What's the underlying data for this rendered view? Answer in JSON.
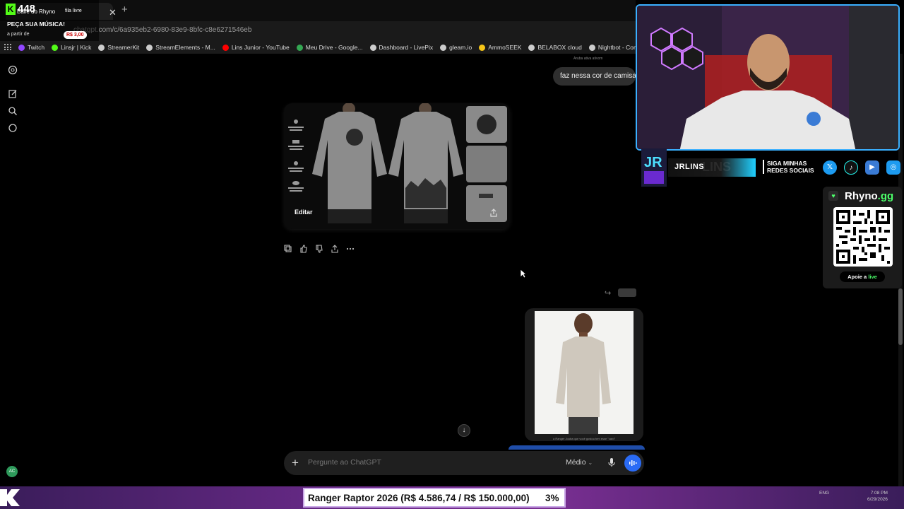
{
  "browser": {
    "url": "chatgpt.com/c/6a935eb2-6980-83e9-8bfc-c8e6271546eb",
    "bookmarks": [
      {
        "label": "Twitch",
        "color": "#9146ff"
      },
      {
        "label": "Linsjr | Kick",
        "color": "#53fc18"
      },
      {
        "label": "StreamerKit",
        "color": "#cccccc"
      },
      {
        "label": "StreamElements - M...",
        "color": "#cccccc"
      },
      {
        "label": "Lins Junior - YouTube",
        "color": "#ff0000"
      },
      {
        "label": "Meu Drive - Google...",
        "color": "#34a853"
      },
      {
        "label": "Dashboard - LivePix",
        "color": "#cccccc"
      },
      {
        "label": "gleam.io",
        "color": "#cccccc"
      },
      {
        "label": "AmmoSEEK",
        "color": "#f5c518"
      },
      {
        "label": "BELABOX cloud",
        "color": "#cccccc"
      },
      {
        "label": "Nightbot - Comm",
        "color": "#cccccc"
      }
    ]
  },
  "stream_overlay": {
    "viewer_count": "448",
    "song_title": "Baile do Rhyno",
    "fila_label": "fila livre",
    "peca_label": "PEÇA SUA MÚSICA!",
    "apartir_label": "a partir de",
    "price": "R$ 3,00"
  },
  "chat": {
    "user_message_1": "faz nessa cor de camisa",
    "top_note": "Aruba ativa ativom",
    "edit_label": "Editar",
    "image_caption": "a Ranger Jouba que você gostou tem esse \"card\"",
    "composer_placeholder": "Pergunte ao ChatGPT",
    "model_label": "Médio",
    "account_initials": "AC"
  },
  "social": {
    "handle": "JRLINS",
    "handle_ghost": "LINS",
    "cta": "SIGA MINHAS REDES SOCIAIS"
  },
  "rhyno": {
    "title_main": "Rhyno",
    "title_tld": ".gg",
    "support_prefix": "Apoie a",
    "support_word": "live"
  },
  "goal": {
    "text": "Ranger Raptor 2026 (R$ 4.586,74 / R$ 150.000,00)",
    "percent": "3%"
  },
  "taskbar": {
    "lang": "ENG",
    "time": "7:08 PM",
    "date": "6/29/2026"
  },
  "colors": {
    "accent_blue": "#2a6bf5",
    "kick_green": "#53fc18",
    "rhyno_green": "#4cff6a",
    "webcam_border": "#3ab0ff"
  }
}
